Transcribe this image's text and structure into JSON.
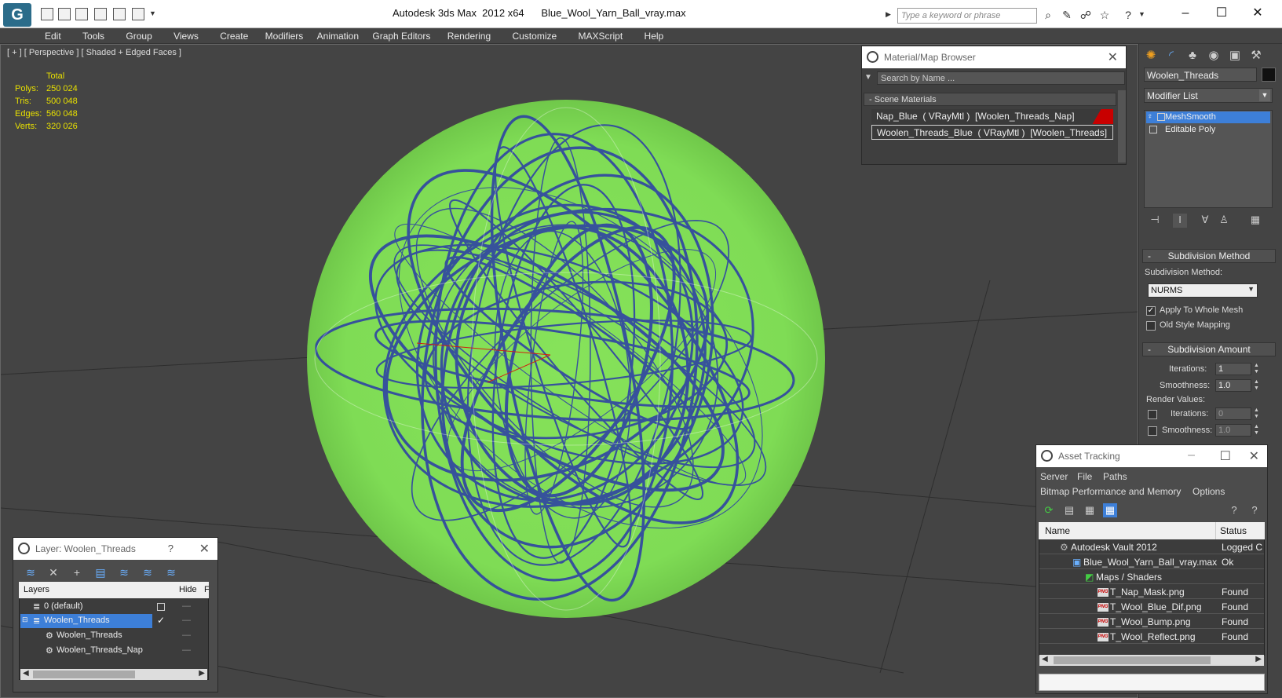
{
  "app": {
    "window_title": "Autodesk 3ds Max  2012 x64",
    "file_title": "Blue_Wool_Yarn_Ball_vray.max",
    "search_placeholder": "Type a keyword or phrase"
  },
  "menu": [
    "Edit",
    "Tools",
    "Group",
    "Views",
    "Create",
    "Modifiers",
    "Animation",
    "Graph Editors",
    "Rendering",
    "Customize",
    "MAXScript",
    "Help"
  ],
  "viewport": {
    "label": "[ + ] [ Perspective ] [ Shaded + Edged Faces ]",
    "stats_header": "Total",
    "stats": [
      {
        "key": "Polys:",
        "value": "250 024"
      },
      {
        "key": "Tris:",
        "value": "500 048"
      },
      {
        "key": "Edges:",
        "value": "560 048"
      },
      {
        "key": "Verts:",
        "value": "320 026"
      }
    ],
    "wire_color": "#86e25a",
    "thread_color": "#2a3aa8"
  },
  "material_browser": {
    "title": "Material/Map Browser",
    "search": "Search by Name ...",
    "section": "Scene Materials",
    "materials": [
      "Nap_Blue  ( VRayMtl )  [Woolen_Threads_Nap]",
      "Woolen_Threads_Blue  ( VRayMtl )  [Woolen_Threads]"
    ]
  },
  "command_panel": {
    "object_name": "Woolen_Threads",
    "modifier_list": "Modifier List",
    "stack": [
      "MeshSmooth",
      "Editable Poly"
    ],
    "subdivision_method": {
      "header": "Subdivision Method",
      "label": "Subdivision Method:",
      "value": "NURMS",
      "apply_whole_mesh": "Apply To Whole Mesh",
      "old_style": "Old Style Mapping"
    },
    "subdivision_amount": {
      "header": "Subdivision Amount",
      "iterations_label": "Iterations:",
      "iterations": "1",
      "smoothness_label": "Smoothness:",
      "smoothness": "1.0",
      "render_values": "Render Values:",
      "r_iterations_label": "Iterations:",
      "r_iterations": "0",
      "r_smoothness_label": "Smoothness:",
      "r_smoothness": "1.0"
    }
  },
  "layer_manager": {
    "title": "Layer: Woolen_Threads",
    "help": "?",
    "col_layers": "Layers",
    "col_hide": "Hide",
    "col_f": "F",
    "rows": [
      {
        "name": "0 (default)"
      },
      {
        "name": "Woolen_Threads"
      },
      {
        "name": "Woolen_Threads"
      },
      {
        "name": "Woolen_Threads_Nap"
      }
    ]
  },
  "asset_tracking": {
    "title": "Asset Tracking",
    "menu1": [
      "Server",
      "File",
      "Paths"
    ],
    "menu2": [
      "Bitmap Performance and Memory",
      "Options"
    ],
    "col_name": "Name",
    "col_status": "Status",
    "rows": [
      {
        "name": "Autodesk Vault 2012",
        "status": "Logged C"
      },
      {
        "name": "Blue_Wool_Yarn_Ball_vray.max",
        "status": "Ok"
      },
      {
        "name": "Maps / Shaders",
        "status": ""
      },
      {
        "name": "T_Nap_Mask.png",
        "status": "Found"
      },
      {
        "name": "T_Wool_Blue_Dif.png",
        "status": "Found"
      },
      {
        "name": "T_Wool_Bump.png",
        "status": "Found"
      },
      {
        "name": "T_Wool_Reflect.png",
        "status": "Found"
      }
    ]
  },
  "icons": [
    "app-logo-icon",
    "open-icon",
    "save-icon",
    "new-icon",
    "undo-icon",
    "binoculars-icon",
    "star-icon",
    "help-icon",
    "sun-icon",
    "curve-icon",
    "hierarchy-icon",
    "motion-icon",
    "display-icon",
    "utilities-icon",
    "lightbulb-icon",
    "pin-icon",
    "refresh-icon",
    "png-icon"
  ]
}
